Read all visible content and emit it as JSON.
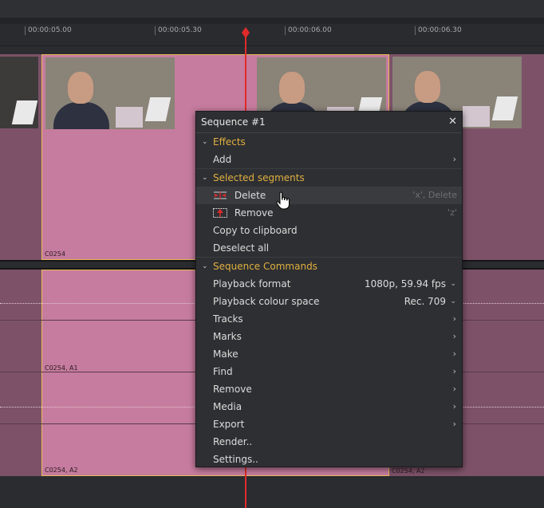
{
  "ruler": {
    "ticks": [
      "00:00:05.00",
      "00:00:05.30",
      "00:00:06.00",
      "00:00:06.30"
    ]
  },
  "clips": {
    "video_label": "C0254",
    "audio1_label": "C0254, A1",
    "audio2_label": "C0254, A2",
    "audio2_right_label": "C0254, A2"
  },
  "menu": {
    "title": "Sequence #1",
    "close_glyph": "✕",
    "sections": {
      "effects": "Effects",
      "selected_segments": "Selected segments",
      "sequence_commands": "Sequence Commands"
    },
    "items": {
      "add": "Add",
      "delete": "Delete",
      "delete_shortcut": "'x', Delete",
      "remove_seg": "Remove",
      "remove_seg_shortcut": "'z'",
      "copy": "Copy to clipboard",
      "deselect": "Deselect all",
      "playback_format": "Playback format",
      "playback_format_value": "1080p, 59.94 fps",
      "playback_colour": "Playback colour space",
      "playback_colour_value": "Rec. 709",
      "tracks": "Tracks",
      "marks": "Marks",
      "make": "Make",
      "find": "Find",
      "remove": "Remove",
      "media": "Media",
      "export": "Export",
      "render": "Render..",
      "settings": "Settings.."
    }
  },
  "colors": {
    "accent": "#e0b040",
    "playhead": "#e02a2a",
    "clip_selected": "#c67c9e",
    "clip_dim": "#7d5268"
  }
}
